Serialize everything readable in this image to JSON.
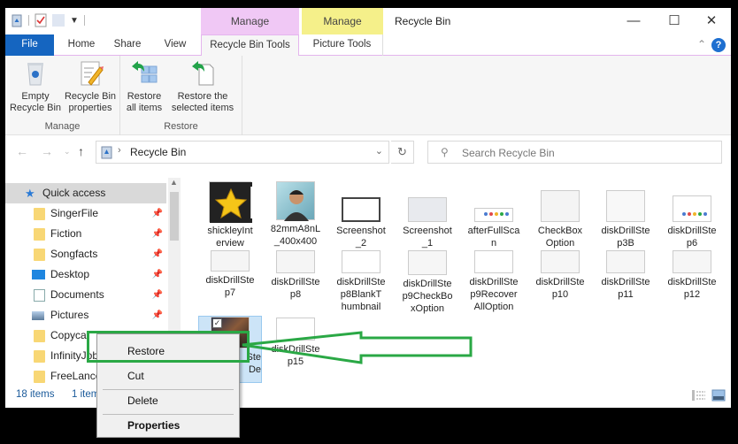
{
  "window": {
    "title": "Recycle Bin",
    "minimize": "—",
    "maximize": "☐",
    "close": "✕"
  },
  "context_tabs": [
    {
      "label": "Manage",
      "color": "#f0c8f5"
    },
    {
      "label": "Manage",
      "color": "#f5f08a"
    }
  ],
  "ribbon_tabs": [
    {
      "label": "File"
    },
    {
      "label": "Home"
    },
    {
      "label": "Share"
    },
    {
      "label": "View"
    },
    {
      "label": "Recycle Bin Tools"
    },
    {
      "label": "Picture Tools"
    }
  ],
  "ribbon": {
    "groups": [
      {
        "label": "Manage",
        "buttons": [
          {
            "line1": "Empty",
            "line2": "Recycle Bin",
            "icon": "recycle-bin-icon"
          },
          {
            "line1": "Recycle Bin",
            "line2": "properties",
            "icon": "properties-icon"
          }
        ]
      },
      {
        "label": "Restore",
        "buttons": [
          {
            "line1": "Restore",
            "line2": "all items",
            "icon": "restore-all-icon"
          },
          {
            "line1": "Restore the",
            "line2": "selected items",
            "icon": "restore-selected-icon"
          }
        ]
      }
    ]
  },
  "address": {
    "breadcrumb": "Recycle Bin",
    "search_placeholder": "Search Recycle Bin"
  },
  "nav": {
    "quick_access": "Quick access",
    "items": [
      {
        "label": "SingerFile",
        "type": "folder"
      },
      {
        "label": "Fiction",
        "type": "folder"
      },
      {
        "label": "Songfacts",
        "type": "folder"
      },
      {
        "label": "Desktop",
        "type": "desktop"
      },
      {
        "label": "Documents",
        "type": "documents"
      },
      {
        "label": "Pictures",
        "type": "pictures"
      },
      {
        "label": "Copycat",
        "type": "folder"
      },
      {
        "label": "InfinityJob",
        "type": "folder"
      },
      {
        "label": "FreeLance",
        "type": "folder"
      }
    ]
  },
  "files": [
    {
      "line1": "shickleyInt",
      "line2": "erview",
      "line3": ""
    },
    {
      "line1": "82mmA8nL",
      "line2": "_400x400",
      "line3": ""
    },
    {
      "line1": "Screenshot",
      "line2": "_2",
      "line3": ""
    },
    {
      "line1": "Screenshot",
      "line2": "_1",
      "line3": ""
    },
    {
      "line1": "afterFullSca",
      "line2": "n",
      "line3": ""
    },
    {
      "line1": "CheckBox",
      "line2": "Option",
      "line3": ""
    },
    {
      "line1": "diskDrillSte",
      "line2": "p3B",
      "line3": ""
    },
    {
      "line1": "diskDrillSte",
      "line2": "p6",
      "line3": ""
    },
    {
      "line1": "diskDrillSte",
      "line2": "p7",
      "line3": ""
    },
    {
      "line1": "diskDrillSte",
      "line2": "p8",
      "line3": ""
    },
    {
      "line1": "diskDrillSte",
      "line2": "p8BlankT",
      "line3": "humbnail"
    },
    {
      "line1": "diskDrillSte",
      "line2": "p9CheckBo",
      "line3": "xOption"
    },
    {
      "line1": "diskDrillSte",
      "line2": "p9Recover",
      "line3": "AllOption"
    },
    {
      "line1": "diskDrillSte",
      "line2": "p10",
      "line3": ""
    },
    {
      "line1": "diskDrillSte",
      "line2": "p11",
      "line3": ""
    },
    {
      "line1": "diskDrillSte",
      "line2": "p12",
      "line3": ""
    },
    {
      "line1": "Ste",
      "line2": "De",
      "line3": ""
    },
    {
      "line1": "diskDrillSte",
      "line2": "p15",
      "line3": ""
    }
  ],
  "status": {
    "count": "18 items",
    "selected": "1 item"
  },
  "context_menu": {
    "items": [
      {
        "label": "Restore"
      },
      {
        "label": "Cut"
      },
      {
        "label": "Delete"
      },
      {
        "label": "Properties"
      }
    ]
  },
  "annotation": {
    "color": "#2aa845"
  }
}
